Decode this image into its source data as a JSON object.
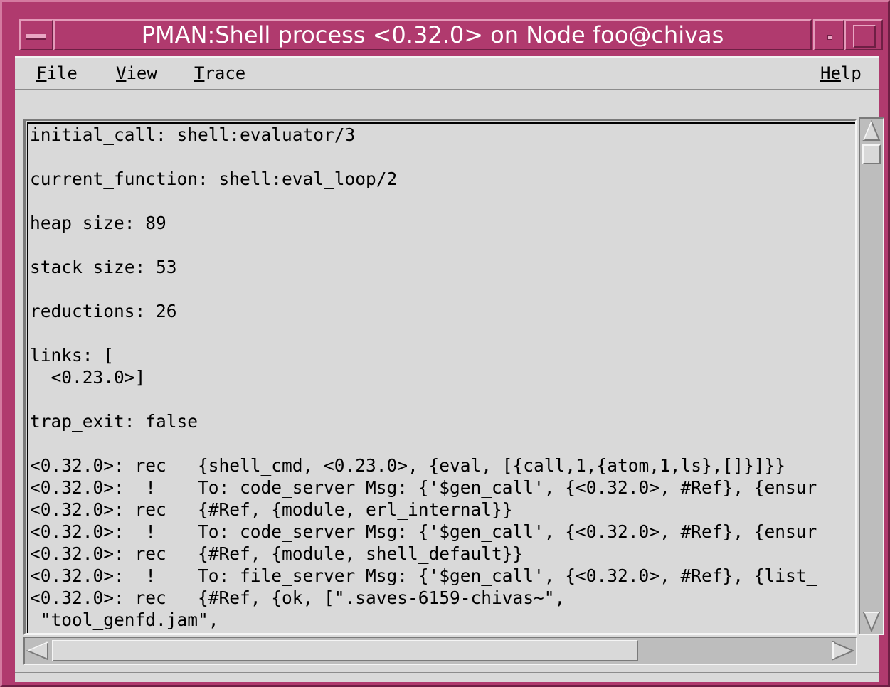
{
  "window": {
    "title": "PMAN:Shell process <0.32.0> on Node foo@chivas"
  },
  "menubar": {
    "file": {
      "mnemonic": "F",
      "rest": "ile"
    },
    "view": {
      "mnemonic": "V",
      "rest": "iew"
    },
    "trace": {
      "mnemonic": "T",
      "rest": "race"
    },
    "help": {
      "mnemonic": "He",
      "rest": "lp",
      "prefix": "",
      "underline_index": 0
    }
  },
  "content": {
    "lines": [
      "initial_call: shell:evaluator/3",
      "",
      "current_function: shell:eval_loop/2",
      "",
      "heap_size: 89",
      "",
      "stack_size: 53",
      "",
      "reductions: 26",
      "",
      "links: [",
      "  <0.23.0>]",
      "",
      "trap_exit: false",
      "",
      "<0.32.0>: rec   {shell_cmd, <0.23.0>, {eval, [{call,1,{atom,1,ls},[]}]}}",
      "<0.32.0>:  !    To: code_server Msg: {'$gen_call', {<0.32.0>, #Ref}, {ensur",
      "<0.32.0>: rec   {#Ref, {module, erl_internal}}",
      "<0.32.0>:  !    To: code_server Msg: {'$gen_call', {<0.32.0>, #Ref}, {ensur",
      "<0.32.0>: rec   {#Ref, {module, shell_default}}",
      "<0.32.0>:  !    To: file_server Msg: {'$gen_call', {<0.32.0>, #Ref}, {list_",
      "<0.32.0>: rec   {#Ref, {ok, [\".saves-6159-chivas~\",",
      " \"tool_genfd.jam\","
    ]
  },
  "scrollbars": {
    "vertical_position": 0.0,
    "horizontal_visible_fraction": 0.73
  },
  "colors": {
    "title_bar": "#b03a6e",
    "client_bg": "#d9d9d9"
  }
}
